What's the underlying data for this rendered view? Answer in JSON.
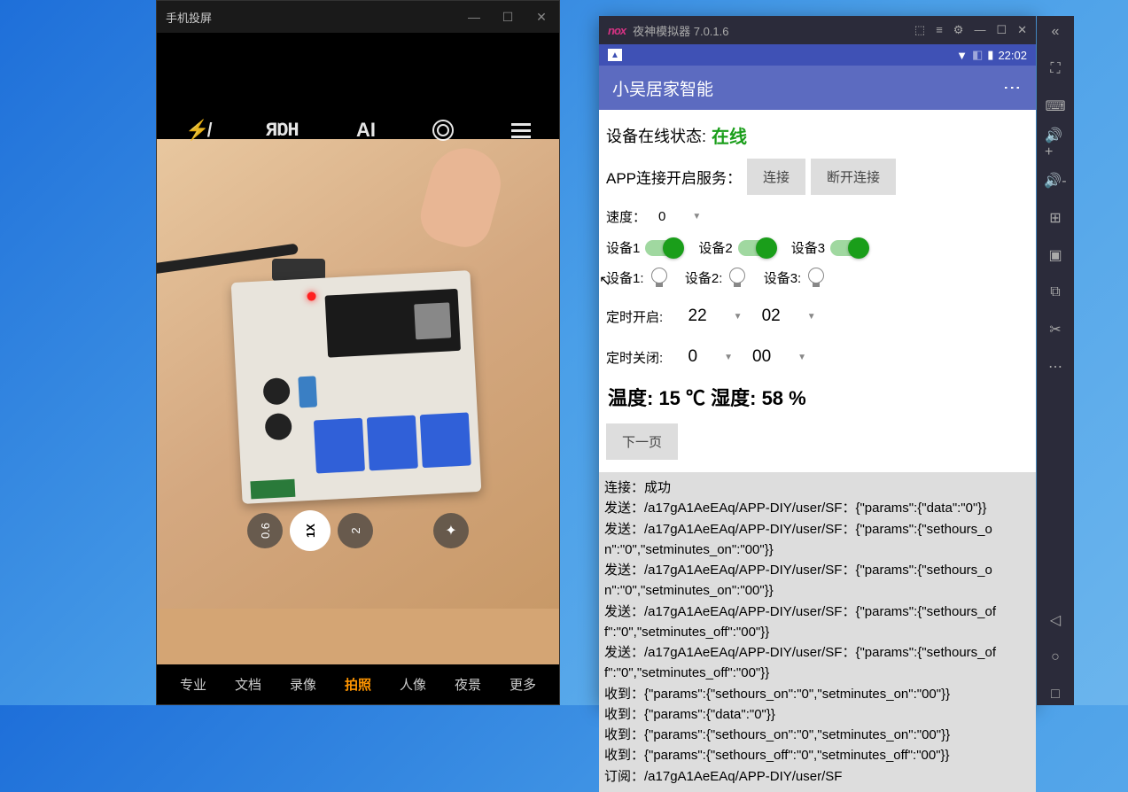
{
  "left_window": {
    "title": "手机投屏",
    "camera": {
      "zoom_levels": [
        "0.6",
        "1X",
        "2"
      ],
      "active_zoom": "1X",
      "modes": [
        "专业",
        "文档",
        "录像",
        "拍照",
        "人像",
        "夜景",
        "更多"
      ],
      "active_mode": "拍照"
    }
  },
  "nox": {
    "title": "夜神模拟器 7.0.1.6",
    "status_time": "22:02"
  },
  "app": {
    "title": "小吴居家智能",
    "device_status_label": "设备在线状态:",
    "device_status_value": "在线",
    "service_label": "APP连接开启服务：",
    "connect_btn": "连接",
    "disconnect_btn": "断开连接",
    "speed_label": "速度：",
    "speed_value": "0",
    "device_toggles": [
      {
        "label": "设备1",
        "on": true
      },
      {
        "label": "设备2",
        "on": true
      },
      {
        "label": "设备3",
        "on": true
      }
    ],
    "device_bulbs": [
      {
        "label": "设备1:"
      },
      {
        "label": "设备2:"
      },
      {
        "label": "设备3:"
      }
    ],
    "timer_on_label": "定时开启:",
    "timer_on_hour": "22",
    "timer_on_min": "02",
    "timer_off_label": "定时关闭:",
    "timer_off_hour": "0",
    "timer_off_min": "00",
    "temp_humidity": "温度: 15 ℃ 湿度: 58 %",
    "next_page_btn": "下一页",
    "logs": [
      "连接：成功",
      "发送：/a17gA1AeEAq/APP-DIY/user/SF：{\"params\":{\"data\":\"0\"}}",
      "发送：/a17gA1AeEAq/APP-DIY/user/SF：{\"params\":{\"sethours_on\":\"0\",\"setminutes_on\":\"00\"}}",
      "发送：/a17gA1AeEAq/APP-DIY/user/SF：{\"params\":{\"sethours_on\":\"0\",\"setminutes_on\":\"00\"}}",
      "发送：/a17gA1AeEAq/APP-DIY/user/SF：{\"params\":{\"sethours_off\":\"0\",\"setminutes_off\":\"00\"}}",
      "发送：/a17gA1AeEAq/APP-DIY/user/SF：{\"params\":{\"sethours_off\":\"0\",\"setminutes_off\":\"00\"}}",
      "收到：{\"params\":{\"sethours_on\":\"0\",\"setminutes_on\":\"00\"}}",
      "收到：{\"params\":{\"data\":\"0\"}}",
      "收到：{\"params\":{\"sethours_on\":\"0\",\"setminutes_on\":\"00\"}}",
      "收到：{\"params\":{\"sethours_off\":\"0\",\"setminutes_off\":\"00\"}}",
      "订阅：/a17gA1AeEAq/APP-DIY/user/SF"
    ]
  }
}
